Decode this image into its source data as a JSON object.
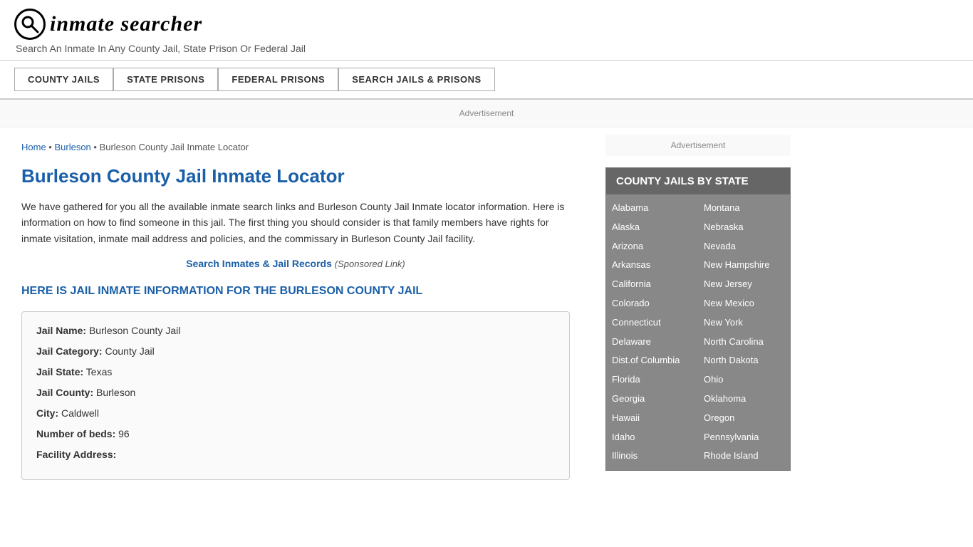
{
  "header": {
    "logo_icon": "🔍",
    "logo_text": "inmate searcher",
    "tagline": "Search An Inmate In Any County Jail, State Prison Or Federal Jail"
  },
  "nav": {
    "buttons": [
      {
        "label": "COUNTY JAILS",
        "key": "county-jails"
      },
      {
        "label": "STATE PRISONS",
        "key": "state-prisons"
      },
      {
        "label": "FEDERAL PRISONS",
        "key": "federal-prisons"
      },
      {
        "label": "SEARCH JAILS & PRISONS",
        "key": "search-jails"
      }
    ]
  },
  "ad_label": "Advertisement",
  "breadcrumb": {
    "home": "Home",
    "parent": "Burleson",
    "current": "Burleson County Jail Inmate Locator"
  },
  "page_title": "Burleson County Jail Inmate Locator",
  "description": "We have gathered for you all the available inmate search links and Burleson County Jail Inmate locator information. Here is information on how to find someone in this jail. The first thing you should consider is that family members have rights for inmate visitation, inmate mail address and policies, and the commissary in Burleson County Jail facility.",
  "sponsored": {
    "link_text": "Search Inmates & Jail Records",
    "label": "(Sponsored Link)"
  },
  "sub_heading": "HERE IS JAIL INMATE INFORMATION FOR THE BURLESON COUNTY JAIL",
  "info": {
    "jail_name_label": "Jail Name:",
    "jail_name_value": "Burleson County Jail",
    "jail_category_label": "Jail Category:",
    "jail_category_value": "County Jail",
    "jail_state_label": "Jail State:",
    "jail_state_value": "Texas",
    "jail_county_label": "Jail County:",
    "jail_county_value": "Burleson",
    "city_label": "City:",
    "city_value": "Caldwell",
    "beds_label": "Number of beds:",
    "beds_value": "96",
    "address_label": "Facility Address:"
  },
  "sidebar": {
    "ad_label": "Advertisement",
    "state_box_title": "COUNTY JAILS BY STATE",
    "states_left": [
      "Alabama",
      "Alaska",
      "Arizona",
      "Arkansas",
      "California",
      "Colorado",
      "Connecticut",
      "Delaware",
      "Dist.of Columbia",
      "Florida",
      "Georgia",
      "Hawaii",
      "Idaho",
      "Illinois"
    ],
    "states_right": [
      "Montana",
      "Nebraska",
      "Nevada",
      "New Hampshire",
      "New Jersey",
      "New Mexico",
      "New York",
      "North Carolina",
      "North Dakota",
      "Ohio",
      "Oklahoma",
      "Oregon",
      "Pennsylvania",
      "Rhode Island"
    ]
  }
}
